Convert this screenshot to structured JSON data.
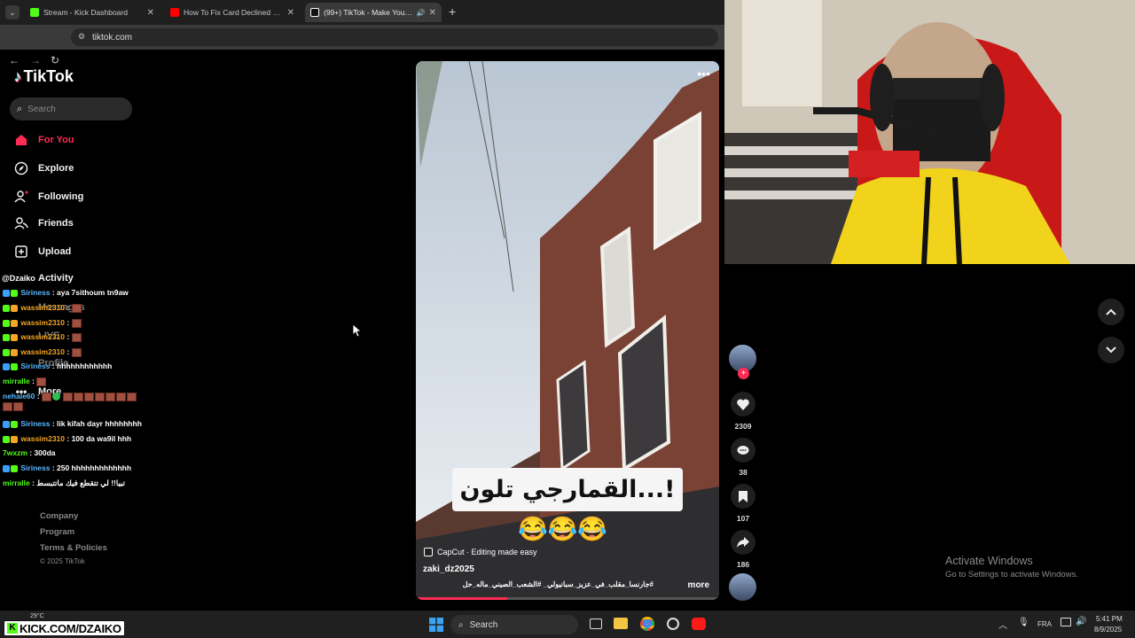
{
  "browser": {
    "tabs": [
      {
        "title": "Stream - Kick Dashboard",
        "favicon_color": "#53fc18"
      },
      {
        "title": "How To Fix Card Declined On E",
        "favicon_color": "#ff0000"
      },
      {
        "title": "(99+) TikTok - Make Your Da",
        "favicon_color": "#ffffff"
      }
    ],
    "url": "tiktok.com"
  },
  "tiktok": {
    "logo_text": "TikTok",
    "search_placeholder": "Search",
    "nav": [
      {
        "label": "For You",
        "icon": "home-icon"
      },
      {
        "label": "Explore",
        "icon": "compass-icon"
      },
      {
        "label": "Following",
        "icon": "following-icon"
      },
      {
        "label": "Friends",
        "icon": "friends-icon"
      },
      {
        "label": "Upload",
        "icon": "upload-icon"
      },
      {
        "label": "Activity",
        "icon": "activity-icon"
      },
      {
        "label": "Messages",
        "icon": "message-icon"
      },
      {
        "label": "LIVE",
        "icon": "live-icon"
      },
      {
        "label": "Profile",
        "icon": "profile-icon"
      },
      {
        "label": "More",
        "icon": "more-icon"
      }
    ],
    "footer": [
      "Company",
      "Program",
      "Terms & Policies"
    ],
    "copyright": "© 2025 TikTok",
    "video": {
      "caption_text": "القمارجي تلون...!",
      "emoji_line": "😂😂😂",
      "capcut_label": "CapCut · Editing made easy",
      "author": "zaki_dz2025",
      "hashtags": "#جارنسا_مقلب_في_عزيز_سبانيولي_ #الشعب_الصيني_ماله_حل",
      "more_label": "more"
    },
    "actions": {
      "likes": "2309",
      "comments": "38",
      "saves": "107",
      "shares": "186"
    }
  },
  "chat": {
    "streamer": "@Dzaiko",
    "messages": [
      {
        "user": "Siriness",
        "color": "#5ab7ff",
        "text": "aya 7sithoum tn9aw"
      },
      {
        "user": "wassim2310",
        "color": "#f5a623",
        "text": ""
      },
      {
        "user": "wassim2310",
        "color": "#f5a623",
        "text": ""
      },
      {
        "user": "wassim2310",
        "color": "#f5a623",
        "text": ""
      },
      {
        "user": "wassim2310",
        "color": "#f5a623",
        "text": ""
      },
      {
        "user": "Siriness",
        "color": "#5ab7ff",
        "text": "hhhhhhhhhhhh"
      },
      {
        "user": "mirralle",
        "color": "#53fc18",
        "text": ""
      },
      {
        "user": "nehale60",
        "color": "#5ab7ff",
        "text": ""
      },
      {
        "user": "Siriness",
        "color": "#5ab7ff",
        "text": "lik kifah dayr hhhhhhhh"
      },
      {
        "user": "wassim2310",
        "color": "#f5a623",
        "text": "100 da wa9il hhh"
      },
      {
        "user": "7wxzm",
        "color": "#53fc18",
        "text": "300da"
      },
      {
        "user": "Siriness",
        "color": "#5ab7ff",
        "text": "250 hhhhhhhhhhhhh"
      },
      {
        "user": "mirralle",
        "color": "#53fc18",
        "text": "تبيا!! لي تتقطع فيك ماتتبسط"
      }
    ]
  },
  "overlay": {
    "kick_banner": "KICK.COM/DZAIKO",
    "watermark_title": "Activate Windows",
    "watermark_sub": "Go to Settings to activate Windows."
  },
  "taskbar": {
    "search_label": "Search",
    "lang": "FRA",
    "time": "5:41 PM",
    "date": "8/9/2025",
    "weather": "29°C"
  }
}
